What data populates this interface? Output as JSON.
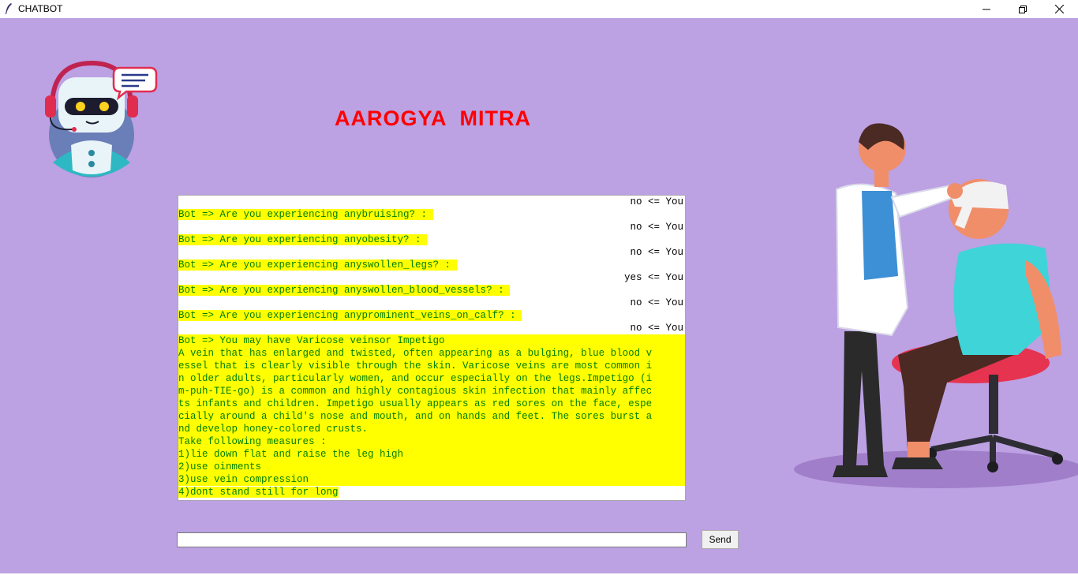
{
  "window": {
    "title": "CHATBOT"
  },
  "header": {
    "title": "AAROGYA  MITRA"
  },
  "chat": {
    "messages": [
      {
        "sender": "user",
        "text": "no <= You"
      },
      {
        "sender": "bot",
        "text": "Bot => Are you experiencing anybruising? : "
      },
      {
        "sender": "blank",
        "text": " "
      },
      {
        "sender": "bot",
        "text": "Bot => Are you experiencing anyobesity? : "
      },
      {
        "sender": "user",
        "text": "no <= You"
      },
      {
        "sender": "bot",
        "text": "Bot => Are you experiencing anyswollen_legs? : "
      },
      {
        "sender": "user",
        "text": "yes <= You"
      },
      {
        "sender": "bot",
        "text": "Bot => Are you experiencing anyswollen_blood_vessels? : "
      },
      {
        "sender": "user",
        "text": "no <= You"
      },
      {
        "sender": "bot",
        "text": "Bot => Are you experiencing anyprominent_veins_on_calf? : "
      },
      {
        "sender": "user",
        "text": "no <= You"
      }
    ],
    "diagnosis_lines": [
      "Bot => You may have Varicose veinsor Impetigo",
      "A vein that has enlarged and twisted, often appearing as a bulging, blue blood v",
      "essel that is clearly visible through the skin. Varicose veins are most common i",
      "n older adults, particularly women, and occur especially on the legs.Impetigo (i",
      "m-puh-TIE-go) is a common and highly contagious skin infection that mainly affec",
      "ts infants and children. Impetigo usually appears as red sores on the face, espe",
      "cially around a child's nose and mouth, and on hands and feet. The sores burst a",
      "nd develop honey-colored crusts.",
      "Take following measures :",
      "1)lie down flat and raise the leg high",
      "2)use oinments",
      "3)use vein compression"
    ],
    "last_line": "4)dont stand still for long"
  },
  "input": {
    "value": "",
    "placeholder": ""
  },
  "send_button": {
    "label": "Send"
  },
  "icons": {
    "app": "feather-icon",
    "minimize": "minimize-icon",
    "maximize": "restore-icon",
    "close": "close-icon",
    "logo": "robot-assistant-icon",
    "illustration": "doctor-bandaging-patient-illustration"
  },
  "colors": {
    "background": "#bca1e3",
    "title": "#ff0000",
    "bot_highlight": "#ffff00",
    "bot_text": "#008000"
  }
}
